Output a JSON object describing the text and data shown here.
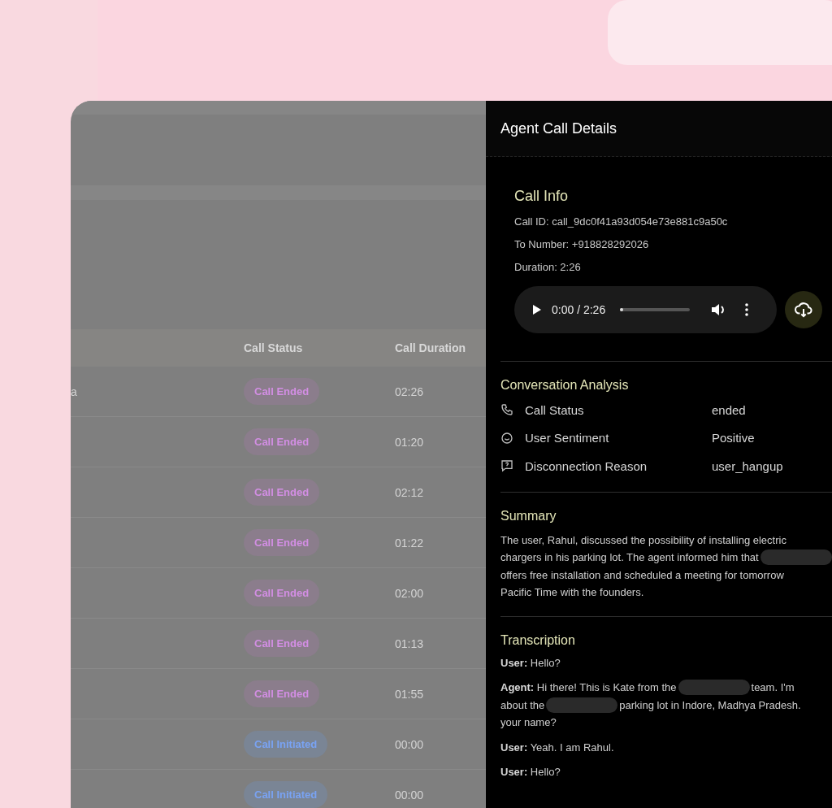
{
  "table": {
    "columns": [
      {
        "label": "Call Status"
      },
      {
        "label": "Call Duration"
      }
    ],
    "rows": [
      {
        "column_1": "a",
        "status": {
          "label": "Call Ended",
          "kind": "ended"
        },
        "duration": "02:26"
      },
      {
        "status": {
          "label": "Call Ended",
          "kind": "ended"
        },
        "duration": "01:20"
      },
      {
        "status": {
          "label": "Call Ended",
          "kind": "ended"
        },
        "duration": "02:12"
      },
      {
        "status": {
          "label": "Call Ended",
          "kind": "ended"
        },
        "duration": "01:22"
      },
      {
        "status": {
          "label": "Call Ended",
          "kind": "ended"
        },
        "duration": "02:00"
      },
      {
        "status": {
          "label": "Call Ended",
          "kind": "ended"
        },
        "duration": "01:13"
      },
      {
        "status": {
          "label": "Call Ended",
          "kind": "ended"
        },
        "duration": "01:55"
      },
      {
        "status": {
          "label": "Call Initiated",
          "kind": "initiated"
        },
        "duration": "00:00"
      },
      {
        "status": {
          "label": "Call Initiated",
          "kind": "initiated"
        },
        "duration": "00:00"
      }
    ]
  },
  "panel": {
    "title": "Agent Call Details",
    "call_info": {
      "heading": "Call Info",
      "lines": [
        "Call ID: call_9dc0f41a93d054e73e881c9a50c",
        "To Number: +918828292026",
        "Duration: 2:26"
      ],
      "player": {
        "time": "0:00 / 2:26",
        "progress": {
          "level": 0
        }
      }
    },
    "analysis": {
      "heading": "Conversation Analysis",
      "rows": [
        {
          "kind": "phone",
          "label": "Call Status",
          "value": "ended"
        },
        {
          "kind": "smile",
          "label": "User Sentiment",
          "value": "Positive"
        },
        {
          "kind": "question",
          "label": "Disconnection Reason",
          "value": "user_hangup"
        }
      ]
    },
    "summary": {
      "heading": "Summary",
      "lines": [
        [
          {
            "kind": "text",
            "text": "The user, Rahul, discussed the possibility of installing electric"
          }
        ],
        [
          {
            "kind": "text",
            "text": "chargers in his parking lot. The agent informed him that"
          },
          {
            "kind": "redacted"
          }
        ],
        [
          {
            "kind": "text",
            "text": "offers free installation and scheduled a meeting for tomorrow"
          }
        ],
        [
          {
            "kind": "text",
            "text": "Pacific Time with the founders."
          }
        ]
      ]
    },
    "transcription": {
      "heading": "Transcription",
      "messages": [
        [
          [
            {
              "kind": "text",
              "text": "**User:** Hello?"
            }
          ]
        ],
        [
          [
            {
              "kind": "text",
              "text": "**Agent:** Hi there! This is Kate from the"
            },
            {
              "kind": "redacted"
            },
            {
              "kind": "text",
              "text": "team. I'm"
            }
          ],
          [
            {
              "kind": "text",
              "text": "about the"
            },
            {
              "kind": "redacted"
            },
            {
              "kind": "text",
              "text": "parking lot in Indore, Madhya Pradesh."
            }
          ],
          [
            {
              "kind": "text",
              "text": "your name?"
            }
          ]
        ],
        [
          [
            {
              "kind": "text",
              "text": "**User:** Yeah. I am Rahul."
            }
          ]
        ],
        [
          [
            {
              "kind": "text",
              "text": "**User:** Hello?"
            }
          ]
        ]
      ]
    }
  }
}
